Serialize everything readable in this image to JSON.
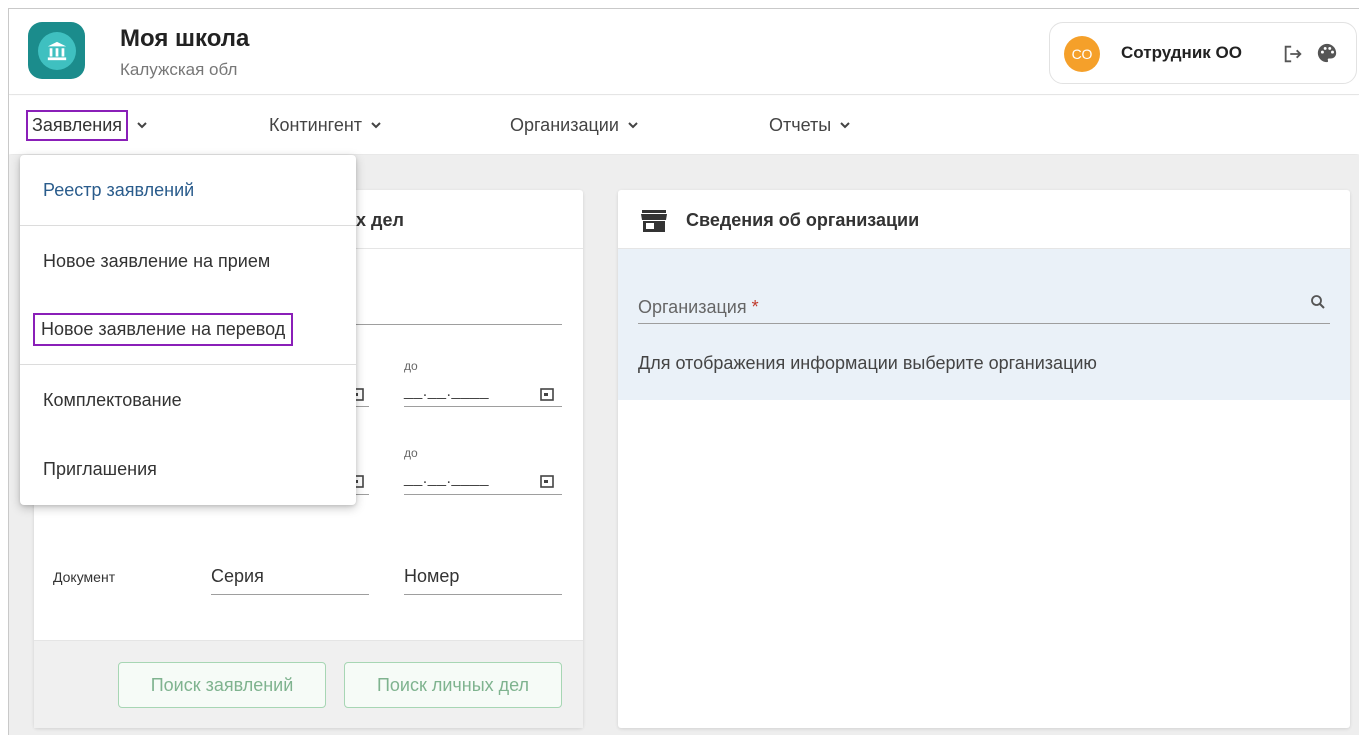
{
  "header": {
    "title": "Моя школа",
    "subtitle": "Калужская обл",
    "user_initials": "СО",
    "user_name": "Сотрудник ОО"
  },
  "nav": {
    "items": [
      {
        "label": "Заявления"
      },
      {
        "label": "Контингент"
      },
      {
        "label": "Организации"
      },
      {
        "label": "Отчеты"
      }
    ]
  },
  "dropdown": {
    "items": [
      {
        "label": "Реестр заявлений"
      },
      {
        "label": "Новое заявление на прием"
      },
      {
        "label": "Новое заявление на перевод"
      },
      {
        "label": "Комплектование"
      },
      {
        "label": "Приглашения"
      }
    ]
  },
  "left_card": {
    "title_visible": "х дел",
    "date_to_label_1": "до",
    "date_to_label_2": "до",
    "date_mask": "__.__.____",
    "document_label": "Документ",
    "series_label": "Серия",
    "number_label": "Номер",
    "btn_search_applications": "Поиск заявлений",
    "btn_search_personal": "Поиск личных дел"
  },
  "right_card": {
    "title": "Сведения об организации",
    "org_label": "Организация",
    "org_required": "*",
    "hint": "Для отображения информации выберите организацию"
  },
  "colors": {
    "accent_purple": "#8a1fb8",
    "logo_teal": "#1b8c8c",
    "avatar_orange": "#f5a02a",
    "button_green": "#7fb38f"
  }
}
